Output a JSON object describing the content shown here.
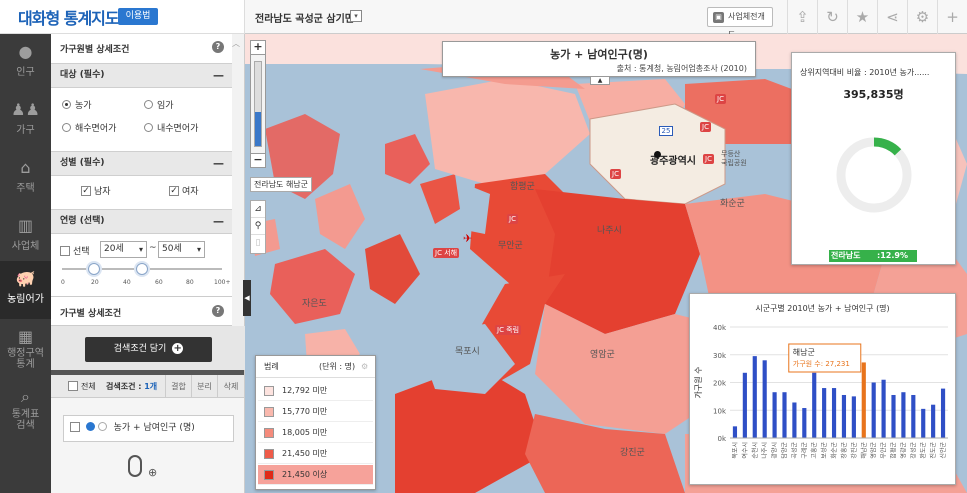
{
  "header": {
    "app_title": "대화형 통계지도",
    "guide_label": "이용법",
    "location": "전라남도 곡성군 삼기면",
    "biz_button": "사업체전개도"
  },
  "icons": {
    "toolbar": [
      "upload-icon",
      "refresh-icon",
      "star-icon",
      "share-icon",
      "gear-icon",
      "plus-icon"
    ]
  },
  "menu": [
    {
      "label": "인구",
      "icon": "person-icon",
      "active": false
    },
    {
      "label": "가구",
      "icon": "family-icon",
      "active": false
    },
    {
      "label": "주택",
      "icon": "house-icon",
      "active": false
    },
    {
      "label": "사업체",
      "icon": "building-icon",
      "active": false
    },
    {
      "label": "농림어가",
      "icon": "pig-icon",
      "active": true
    },
    {
      "label": "행정구역\n통계",
      "icon": "map-icon",
      "active": false
    },
    {
      "label": "통계표\n검색",
      "icon": "search-icon",
      "active": false
    }
  ],
  "panel": {
    "header": "가구원별 상세조건",
    "target": {
      "title": "대상 (필수)",
      "options": [
        "농가",
        "임가",
        "해수면어가",
        "내수면어가"
      ],
      "selected": "농가"
    },
    "gender": {
      "title": "성별 (필수)",
      "options": [
        "남자",
        "여자"
      ]
    },
    "age": {
      "title": "연령 (선택)",
      "select_label": "선택",
      "from": "20세",
      "separator": "~",
      "to": "50세",
      "ticks": [
        "0",
        "20",
        "40",
        "60",
        "80",
        "100+"
      ]
    },
    "household_header": "가구별 상세조건",
    "search_button": "검색조건 담기",
    "list": {
      "all_label": "전체",
      "count_label": "검색조건 : ",
      "count_value": "1개",
      "cols": [
        "결합",
        "분리",
        "삭제"
      ],
      "item_label": "농가 + 남여인구 (명)"
    }
  },
  "map": {
    "title": "농가 + 남여인구(명)",
    "source": "출처 : 통계청, 농림어업총조사 (2010)",
    "region_label": "전라남도 해남군",
    "labels": {
      "gwangju": "광주광역시",
      "naju": "나주시",
      "hwasun": "화순군",
      "muan": "무안군",
      "yeongam": "영암군",
      "mokpo": "목포시",
      "jaeun": "자은도",
      "gangjin": "강진군",
      "hampyeong": "함평군",
      "mudeung": "무등산\n국립공원"
    },
    "jc_labels": [
      "JC",
      "JC",
      "JC",
      "JC",
      "JC",
      "JC 죽림",
      "JC 서해"
    ],
    "road_numbers": [
      "25"
    ]
  },
  "stat_card": {
    "title": "상위지역대비 비율 : 2010년 농가......",
    "value": "395,835명",
    "region": "전라남도",
    "ratio": ":12.9%",
    "ratio_value": 12.9,
    "accent": "#36b14a"
  },
  "legend": {
    "title": "범례",
    "unit": "(단위 : 명)",
    "items": [
      {
        "label": "12,792 미만",
        "color": "#fde3df"
      },
      {
        "label": "15,770 미만",
        "color": "#f9b8ad"
      },
      {
        "label": "18,005 미만",
        "color": "#f58b7c"
      },
      {
        "label": "21,450 미만",
        "color": "#ef5b49"
      },
      {
        "label": "21,450 이상",
        "color": "#e02a18"
      }
    ]
  },
  "chart_data": {
    "type": "bar",
    "title": "시군구별 2010년 농가 + 남여인구 (명)",
    "ylabel": "가구원 수",
    "ylim": [
      0,
      40000
    ],
    "yticks": [
      "0k",
      "10k",
      "20k",
      "30k",
      "40k"
    ],
    "categories": [
      "목포시",
      "여수시",
      "순천시",
      "나주시",
      "광양시",
      "담양군",
      "곡성군",
      "구례군",
      "고흥군",
      "보성군",
      "화순군",
      "장흥군",
      "강진군",
      "해남군",
      "영암군",
      "무안군",
      "함평군",
      "영광군",
      "장성군",
      "완도군",
      "진도군",
      "신안군"
    ],
    "values": [
      4200,
      23500,
      29500,
      28000,
      16500,
      16500,
      12800,
      10800,
      23500,
      18000,
      18000,
      15500,
      15000,
      27231,
      20000,
      21000,
      15500,
      16500,
      15500,
      10500,
      12000,
      17800
    ],
    "highlight_index": 13,
    "bar_color": "#2f4fc6",
    "highlight_color": "#e8741c",
    "tooltip": {
      "title": "해남군",
      "text": "가구원 수: 27,231"
    }
  }
}
